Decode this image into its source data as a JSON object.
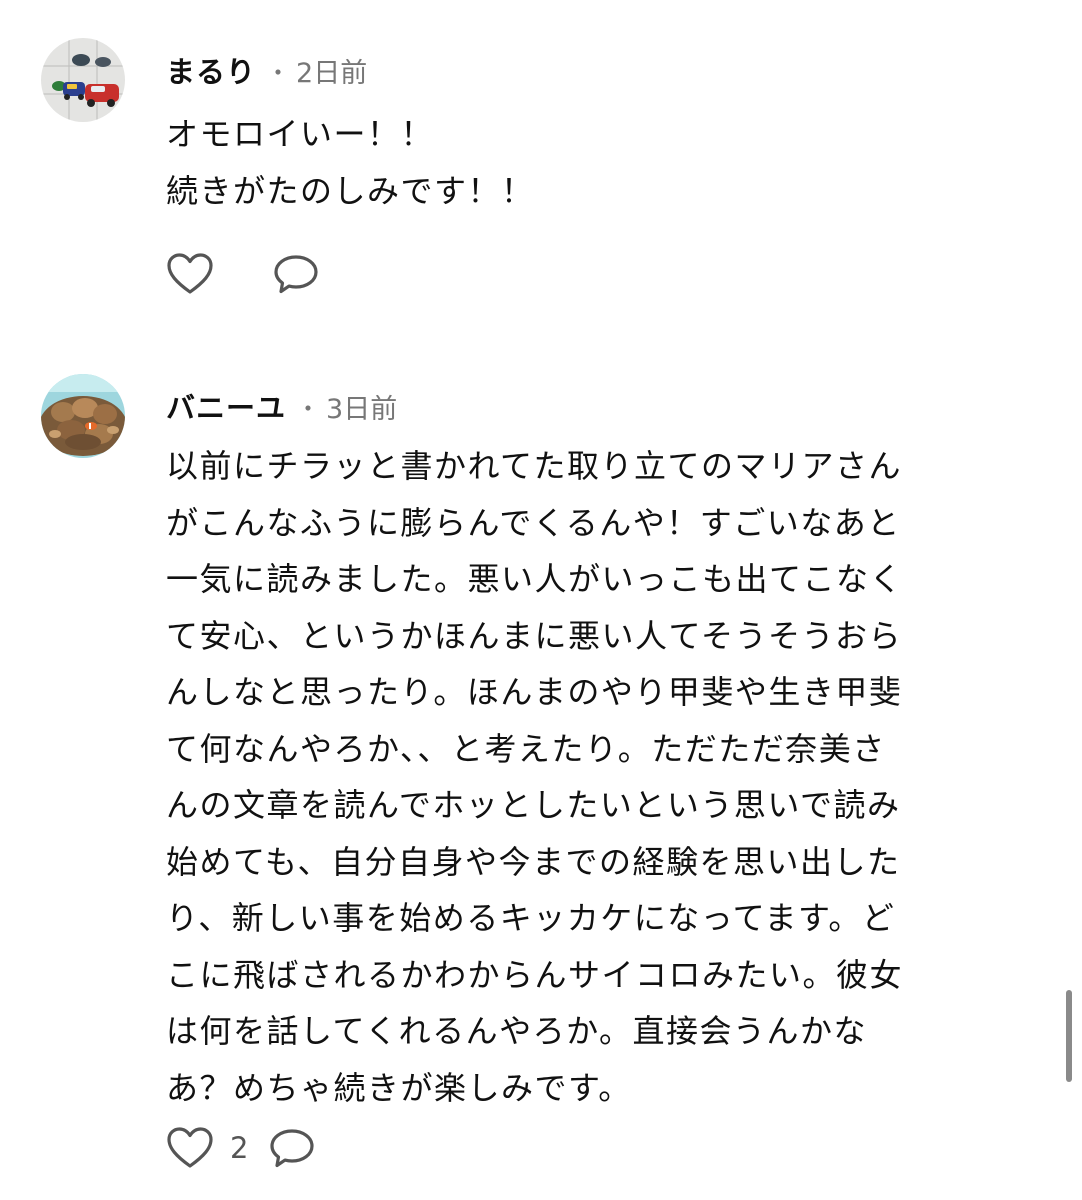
{
  "comments": [
    {
      "author": "まるり",
      "separator": "・",
      "time": "2日前",
      "avatar_icon": "toy-cars-avatar",
      "lines": [
        "オモロイいー！！",
        "続きがたのしみです！！"
      ],
      "like_icon": "heart-outline-icon",
      "reply_icon": "speech-bubble-icon",
      "like_count": ""
    },
    {
      "author": "バニーユ",
      "separator": "・",
      "time": "3日前",
      "avatar_icon": "coral-anemone-avatar",
      "lines": [
        "以前にチラッと書かれてた取り立てのマリアさん",
        "がこんなふうに膨らんでくるんや！すごいなあと",
        "一気に読みました。悪い人がいっこも出てこなく",
        "て安心、というかほんまに悪い人てそうそうおら",
        "んしなと思ったり。ほんまのやり甲斐や生き甲斐",
        "て何なんやろか、、と考えたり。ただただ奈美さ",
        "んの文章を読んでホッとしたいという思いで読み",
        "始めても、自分自身や今までの経験を思い出した",
        "り、新しい事を始めるキッカケになってます。ど",
        "こに飛ばされるかわからんサイコロみたい。彼女",
        "は何を話してくれるんやろか。直接会うんかな",
        "あ？めちゃ続きが楽しみです。"
      ],
      "like_icon": "heart-outline-icon",
      "reply_icon": "speech-bubble-icon",
      "like_count": "2"
    }
  ],
  "colors": {
    "text": "#111111",
    "meta": "#777777",
    "icon": "#555555",
    "scrollbar": "#8a8a8a"
  }
}
